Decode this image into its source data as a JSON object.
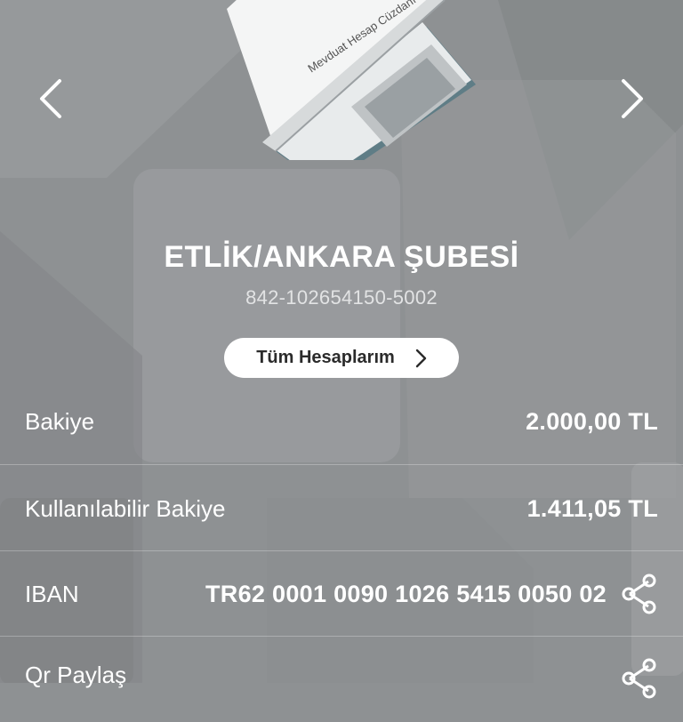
{
  "branch": {
    "name": "ETLİK/ANKARA ŞUBESİ",
    "account_number": "842-102654150-5002",
    "booklet_text": "Mevduat Hesap Cüzdanı"
  },
  "all_accounts_label": "Tüm Hesaplarım",
  "rows": {
    "balance": {
      "label": "Bakiye",
      "value": "2.000,00 TL"
    },
    "available": {
      "label": "Kullanılabilir Bakiye",
      "value": "1.411,05 TL"
    },
    "iban": {
      "label": "IBAN",
      "value": "TR62 0001 0090 1026 5415 0050 02"
    },
    "qr": {
      "label": "Qr Paylaş"
    }
  },
  "icons": [
    "chevron-left-icon",
    "chevron-right-icon",
    "share-icon"
  ],
  "colors": {
    "background": "#8e9193",
    "text": "#ffffff",
    "button_bg": "#ffffff",
    "button_text": "#2b2b2b"
  }
}
